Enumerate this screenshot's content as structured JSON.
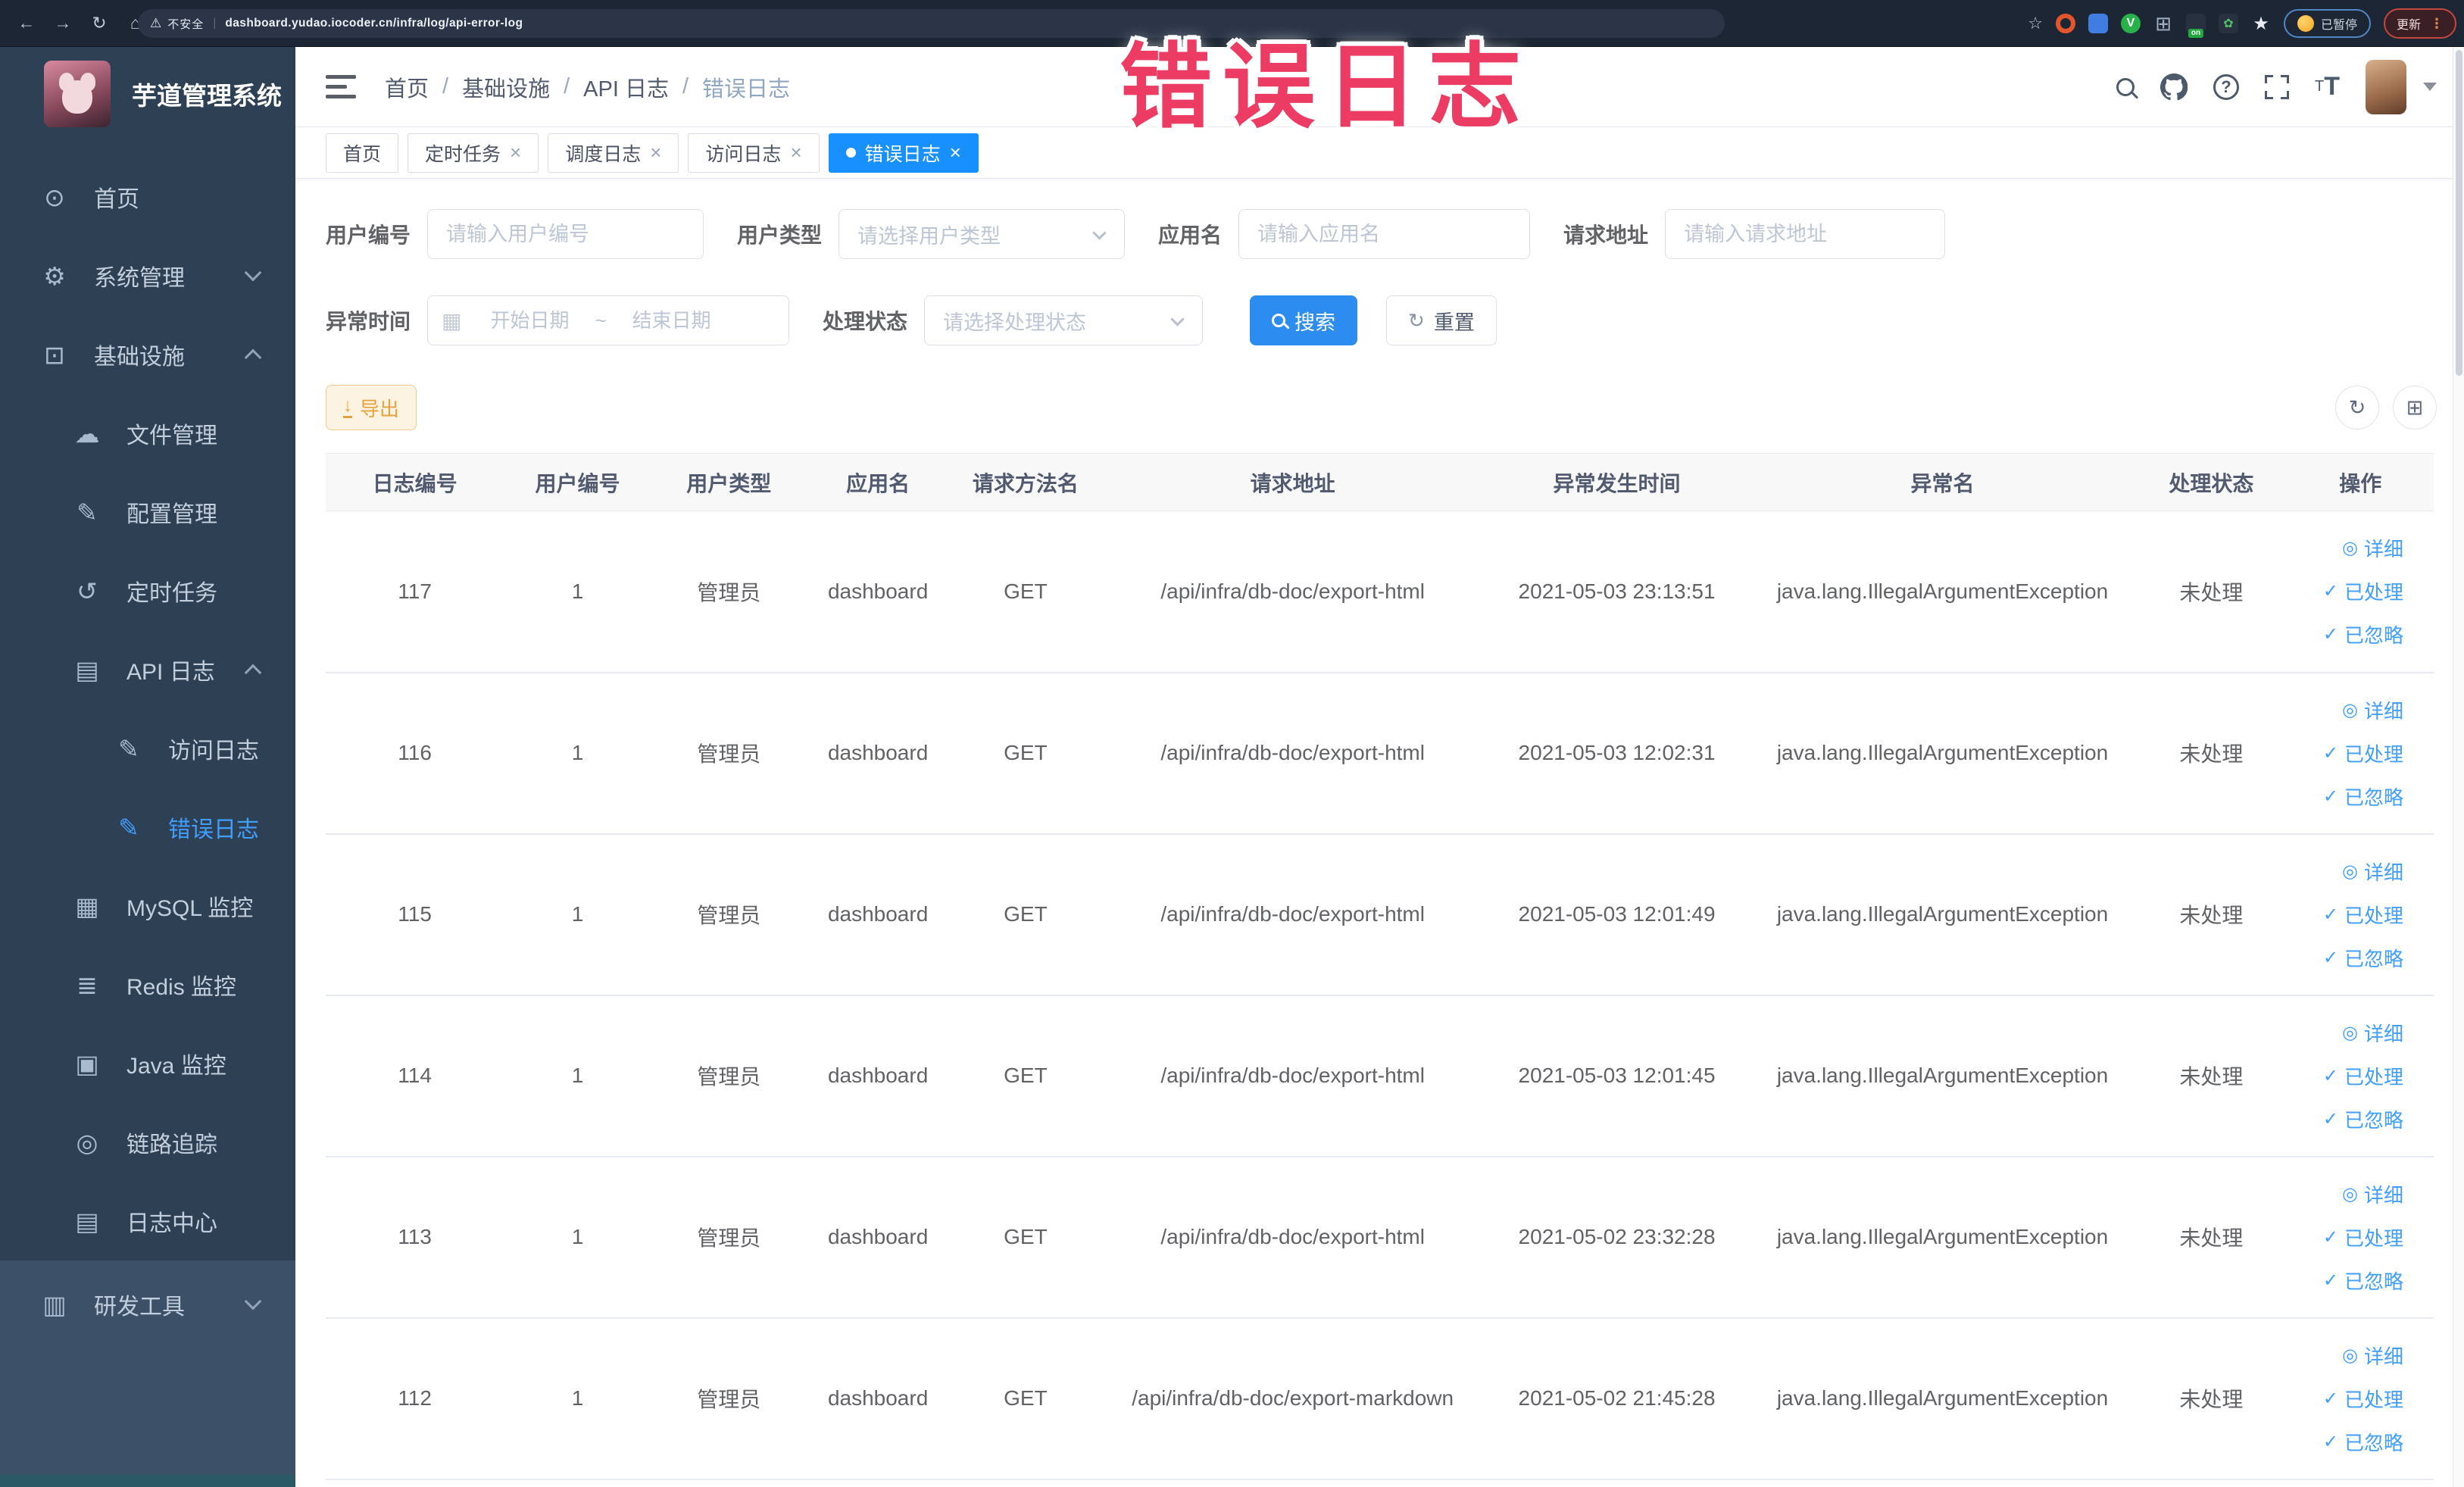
{
  "browser": {
    "security_label": "不安全",
    "url": "dashboard.yudao.iocoder.cn/infra/log/api-error-log",
    "extension_badge": "on",
    "paused_label": "已暂停",
    "update_label": "更新"
  },
  "overlay": {
    "title": "错误日志"
  },
  "sidebar": {
    "app_title": "芋道管理系统",
    "items": [
      {
        "label": "首页"
      },
      {
        "label": "系统管理"
      },
      {
        "label": "基础设施"
      },
      {
        "label": "文件管理"
      },
      {
        "label": "配置管理"
      },
      {
        "label": "定时任务"
      },
      {
        "label": "API 日志"
      },
      {
        "label": "访问日志"
      },
      {
        "label": "错误日志"
      },
      {
        "label": "MySQL 监控"
      },
      {
        "label": "Redis 监控"
      },
      {
        "label": "Java 监控"
      },
      {
        "label": "链路追踪"
      },
      {
        "label": "日志中心"
      },
      {
        "label": "研发工具"
      }
    ]
  },
  "header": {
    "breadcrumb": [
      "首页",
      "基础设施",
      "API 日志",
      "错误日志"
    ]
  },
  "tabs": [
    {
      "label": "首页"
    },
    {
      "label": "定时任务"
    },
    {
      "label": "调度日志"
    },
    {
      "label": "访问日志"
    },
    {
      "label": "错误日志"
    }
  ],
  "filters": {
    "user_id": {
      "label": "用户编号",
      "placeholder": "请输入用户编号"
    },
    "user_type": {
      "label": "用户类型",
      "placeholder": "请选择用户类型"
    },
    "app_name": {
      "label": "应用名",
      "placeholder": "请输入应用名"
    },
    "request_url": {
      "label": "请求地址",
      "placeholder": "请输入请求地址"
    },
    "exception_time": {
      "label": "异常时间",
      "start_placeholder": "开始日期",
      "separator": "~",
      "end_placeholder": "结束日期"
    },
    "process_status": {
      "label": "处理状态",
      "placeholder": "请选择处理状态"
    },
    "search_label": "搜索",
    "reset_label": "重置"
  },
  "toolbar": {
    "export_label": "导出"
  },
  "table": {
    "columns": [
      "日志编号",
      "用户编号",
      "用户类型",
      "应用名",
      "请求方法名",
      "请求地址",
      "异常发生时间",
      "异常名",
      "处理状态",
      "操作"
    ],
    "actions": {
      "detail": "详细",
      "processed": "已处理",
      "ignored": "已忽略"
    },
    "rows": [
      {
        "log_id": "117",
        "user_id": "1",
        "user_type": "管理员",
        "app_name": "dashboard",
        "method": "GET",
        "url": "/api/infra/db-doc/export-html",
        "time": "2021-05-03 23:13:51",
        "exception": "java.lang.IllegalArgumentException",
        "status": "未处理"
      },
      {
        "log_id": "116",
        "user_id": "1",
        "user_type": "管理员",
        "app_name": "dashboard",
        "method": "GET",
        "url": "/api/infra/db-doc/export-html",
        "time": "2021-05-03 12:02:31",
        "exception": "java.lang.IllegalArgumentException",
        "status": "未处理"
      },
      {
        "log_id": "115",
        "user_id": "1",
        "user_type": "管理员",
        "app_name": "dashboard",
        "method": "GET",
        "url": "/api/infra/db-doc/export-html",
        "time": "2021-05-03 12:01:49",
        "exception": "java.lang.IllegalArgumentException",
        "status": "未处理"
      },
      {
        "log_id": "114",
        "user_id": "1",
        "user_type": "管理员",
        "app_name": "dashboard",
        "method": "GET",
        "url": "/api/infra/db-doc/export-html",
        "time": "2021-05-03 12:01:45",
        "exception": "java.lang.IllegalArgumentException",
        "status": "未处理"
      },
      {
        "log_id": "113",
        "user_id": "1",
        "user_type": "管理员",
        "app_name": "dashboard",
        "method": "GET",
        "url": "/api/infra/db-doc/export-html",
        "time": "2021-05-02 23:32:28",
        "exception": "java.lang.IllegalArgumentException",
        "status": "未处理"
      },
      {
        "log_id": "112",
        "user_id": "1",
        "user_type": "管理员",
        "app_name": "dashboard",
        "method": "GET",
        "url": "/api/infra/db-doc/export-markdown",
        "time": "2021-05-02 21:45:28",
        "exception": "java.lang.IllegalArgumentException",
        "status": "未处理"
      }
    ]
  },
  "colors": {
    "accent": "#409eff",
    "active_tab": "#1890ff",
    "warning": "#e6a23c",
    "overlay_pink": "#ec3c63",
    "sidebar_bg": "#2e4154",
    "chrome_bg": "#1d2634"
  }
}
